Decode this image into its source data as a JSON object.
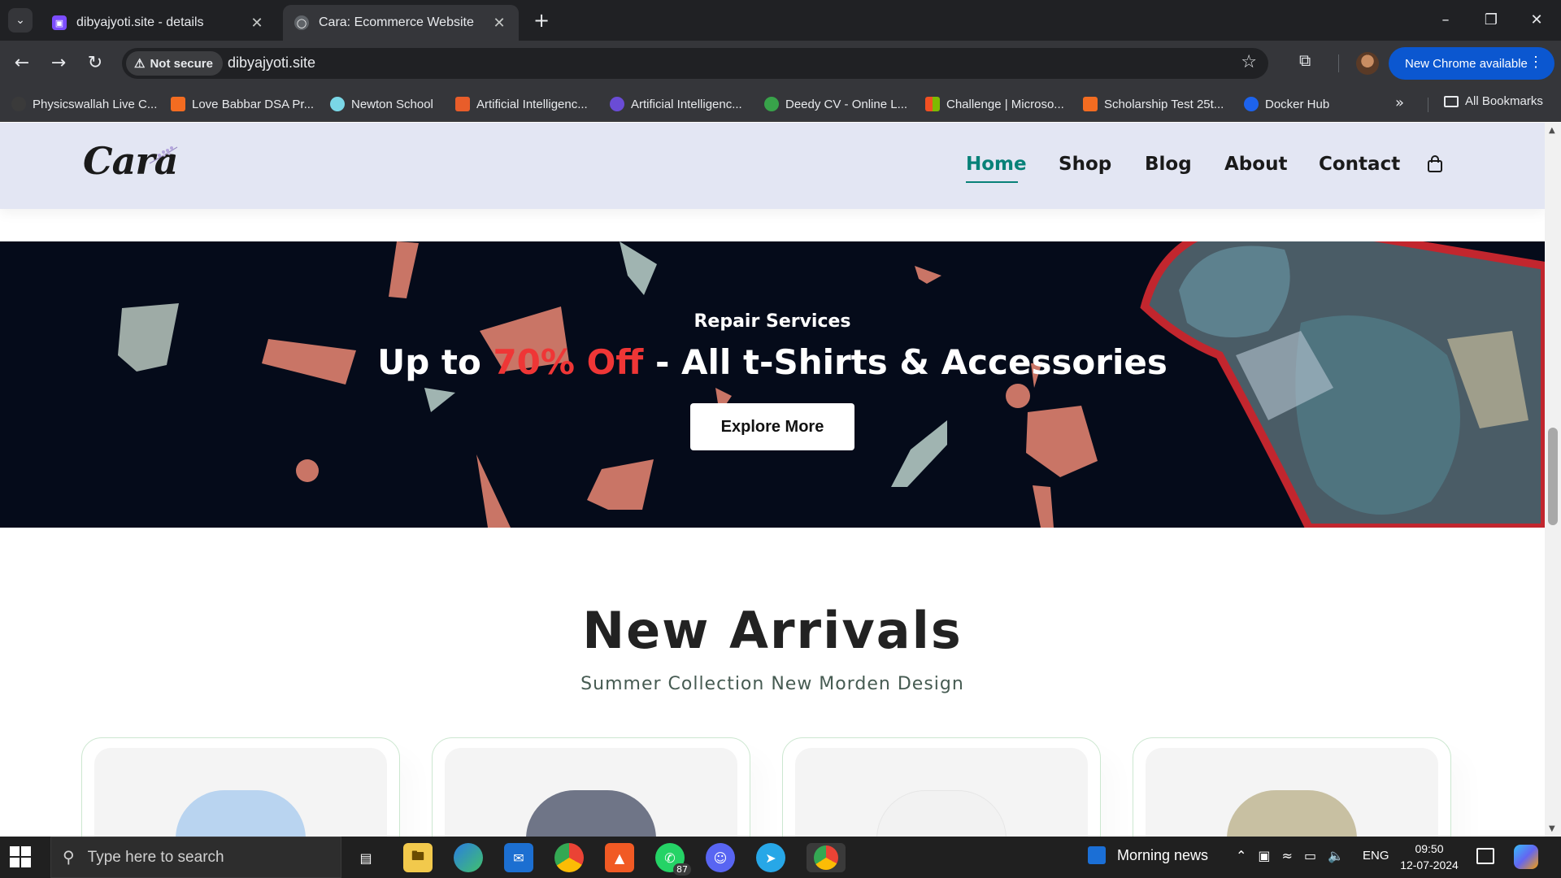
{
  "browser": {
    "tabs": [
      {
        "title": "dibyajyoti.site - details",
        "active": false
      },
      {
        "title": "Cara: Ecommerce Website",
        "active": true
      }
    ],
    "security_label": "Not secure",
    "url": "dibyajyoti.site",
    "update_label": "New Chrome available",
    "bookmarks": [
      {
        "label": "Physicswallah Live C...",
        "color": "#2b2b2b"
      },
      {
        "label": "Love Babbar DSA Pr...",
        "color": "#f36c21"
      },
      {
        "label": "Newton School",
        "color": "#7ad7e7"
      },
      {
        "label": "Artificial Intelligenc...",
        "color": "#e85d2a"
      },
      {
        "label": "Artificial Intelligenc...",
        "color": "#6a4cd6"
      },
      {
        "label": "Deedy CV - Online L...",
        "color": "#38a34a"
      },
      {
        "label": "Challenge | Microso...",
        "color": "#f25022"
      },
      {
        "label": "Scholarship Test 25t...",
        "color": "#f36c21"
      },
      {
        "label": "Docker Hub",
        "color": "#1d63ed"
      }
    ],
    "all_bookmarks_label": "All Bookmarks"
  },
  "site": {
    "logo_text": "Cara",
    "nav": [
      {
        "label": "Home",
        "active": true
      },
      {
        "label": "Shop",
        "active": false
      },
      {
        "label": "Blog",
        "active": false
      },
      {
        "label": "About",
        "active": false
      },
      {
        "label": "Contact",
        "active": false
      }
    ],
    "banner": {
      "subtitle": "Repair Services",
      "title_prefix": "Up to ",
      "title_highlight": "70% Off",
      "title_suffix": " - All t-Shirts & Accessories",
      "button_label": "Explore More",
      "highlight_color": "#ef3636"
    },
    "new_arrivals": {
      "title": "New Arrivals",
      "subtitle": "Summer Collection New Morden Design",
      "products": [
        {
          "shirt_color": "#b9d4f0"
        },
        {
          "shirt_color": "#6f7587"
        },
        {
          "shirt_color": "#f2f2f2"
        },
        {
          "shirt_color": "#c8c0a2"
        }
      ]
    },
    "accent_color": "#088178"
  },
  "taskbar": {
    "search_placeholder": "Type here to search",
    "whatsapp_badge": "87",
    "news_label": "Morning news",
    "language": "ENG",
    "time": "09:50",
    "date": "12-07-2024"
  }
}
